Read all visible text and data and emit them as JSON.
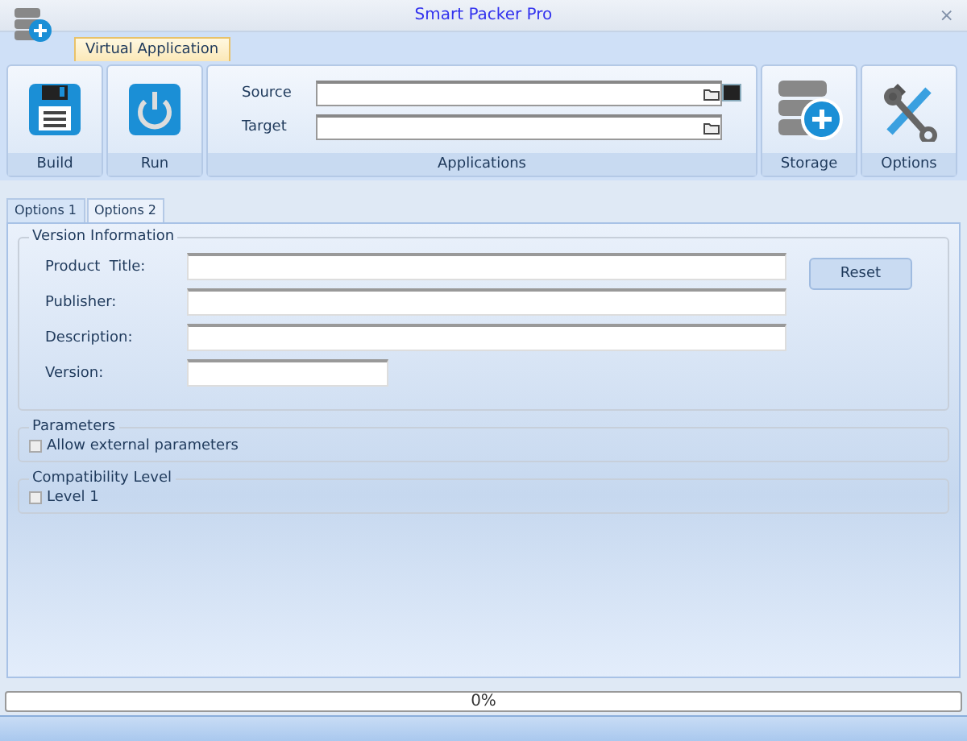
{
  "window": {
    "title": "Smart Packer Pro",
    "close": "×"
  },
  "ribbon_tabs": [
    {
      "label": "Virtual Application",
      "selected": true
    }
  ],
  "ribbon": {
    "groups": [
      {
        "kind": "button",
        "label": "Build"
      },
      {
        "kind": "button",
        "label": "Run"
      },
      {
        "kind": "fields",
        "label": "Applications",
        "fields": [
          {
            "label": "Source"
          },
          {
            "label": "Target"
          }
        ]
      },
      {
        "kind": "button",
        "label": "Storage"
      },
      {
        "kind": "button",
        "label": "Options"
      }
    ]
  },
  "tabs": [
    {
      "label": "Options 1",
      "selected": false
    },
    {
      "label": "Options 2",
      "selected": true
    }
  ],
  "version_information": {
    "title": "Version Information",
    "fields": [
      {
        "label": "Product  Title:"
      },
      {
        "label": "Publisher:"
      },
      {
        "label": "Description:"
      },
      {
        "label": "Version:"
      }
    ],
    "reset_button": "Reset"
  },
  "parameters": {
    "title": "Parameters",
    "options": [
      {
        "label": "Allow external parameters",
        "checked": false
      }
    ]
  },
  "compatibility_level": {
    "title": "Compatibility Level",
    "options": [
      {
        "label": "Level 1",
        "checked": false
      }
    ]
  },
  "progress": {
    "level": 0,
    "reading": "0%"
  }
}
